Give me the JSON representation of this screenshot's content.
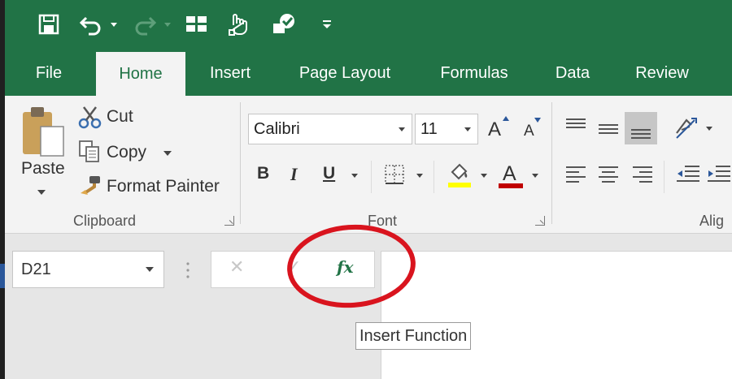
{
  "quick_access": {
    "icons": [
      "save-icon",
      "undo-icon",
      "redo-icon",
      "table-icon",
      "touch-mode-icon",
      "check-icon",
      "customize-icon"
    ]
  },
  "tabs": [
    {
      "label": "File",
      "active": false
    },
    {
      "label": "Home",
      "active": true
    },
    {
      "label": "Insert",
      "active": false
    },
    {
      "label": "Page Layout",
      "active": false
    },
    {
      "label": "Formulas",
      "active": false
    },
    {
      "label": "Data",
      "active": false
    },
    {
      "label": "Review",
      "active": false
    }
  ],
  "clipboard": {
    "paste_label": "Paste",
    "cut_label": "Cut",
    "copy_label": "Copy",
    "format_painter_label": "Format Painter",
    "group_label": "Clipboard"
  },
  "font": {
    "font_name": "Calibri",
    "font_size": "11",
    "bold": "B",
    "italic": "I",
    "underline": "U",
    "grow_label": "A",
    "shrink_label": "A",
    "font_color_label": "A",
    "group_label": "Font",
    "highlight_color": "#ffff00",
    "font_color": "#c00000"
  },
  "alignment": {
    "group_label": "Alig"
  },
  "formula_bar": {
    "name_box": "D21",
    "cancel": "✕",
    "enter": "✓",
    "fx": "fx",
    "tooltip": "Insert Function"
  },
  "colors": {
    "accent": "#217346",
    "annotation": "#d9141e"
  }
}
